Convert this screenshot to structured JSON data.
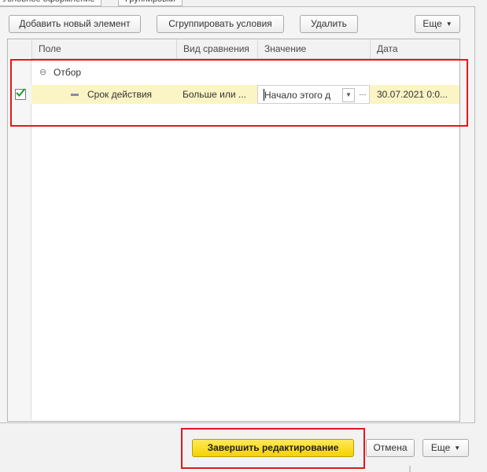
{
  "tabs": [
    {
      "label": "Условное оформление",
      "active": true
    },
    {
      "label": "Группировки",
      "active": false
    }
  ],
  "toolbar": {
    "add_label": "Добавить новый элемент",
    "group_label": "Сгруппировать условия",
    "delete_label": "Удалить",
    "more_label": "Еще"
  },
  "table": {
    "columns": [
      "Поле",
      "Вид сравнения",
      "Значение",
      "Дата"
    ],
    "group_row": {
      "label": "Отбор"
    },
    "rows": [
      {
        "checked": true,
        "field": "Срок действия",
        "comparison": "Больше или ...",
        "value": "Начало этого д",
        "date": "30.07.2021 0:0..."
      }
    ]
  },
  "footer": {
    "finish_label": "Завершить редактирование",
    "cancel_label": "Отмена",
    "more_label": "Еще"
  },
  "colors": {
    "highlight": "#e5171b",
    "selected_row": "#fbf4c4",
    "primary_button": "#f5d200"
  }
}
